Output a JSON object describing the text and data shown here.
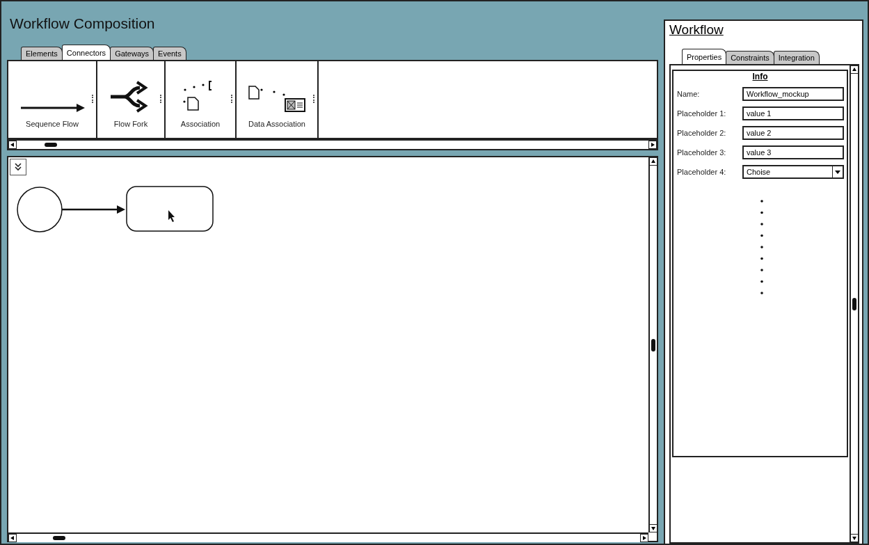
{
  "composition": {
    "title": "Workflow Composition",
    "tabs": [
      {
        "label": "Elements",
        "selected": false
      },
      {
        "label": "Connectors",
        "selected": true
      },
      {
        "label": "Gateways",
        "selected": false
      },
      {
        "label": "Events",
        "selected": false
      }
    ],
    "palette": [
      {
        "kind": "sequence",
        "label": "Sequence Flow"
      },
      {
        "kind": "fork",
        "label": "Flow Fork"
      },
      {
        "kind": "association",
        "label": "Association"
      },
      {
        "kind": "data",
        "label": "Data Association"
      }
    ]
  },
  "properties": {
    "title": "Workflow",
    "tabs": [
      {
        "label": "Properties",
        "selected": true
      },
      {
        "label": "Constraints",
        "selected": false
      },
      {
        "label": "Integration",
        "selected": false
      }
    ],
    "section": "Info",
    "fields": [
      {
        "kind": "text",
        "label": "Name:",
        "value": "Workflow_mockup"
      },
      {
        "kind": "text",
        "label": "Placeholder 1:",
        "value": "value 1"
      },
      {
        "kind": "text",
        "label": "Placeholder 2:",
        "value": "value 2"
      },
      {
        "kind": "text",
        "label": "Placeholder 3:",
        "value": "value 3"
      },
      {
        "kind": "select",
        "label": "Placeholder 4:",
        "value": "Choise"
      }
    ]
  }
}
